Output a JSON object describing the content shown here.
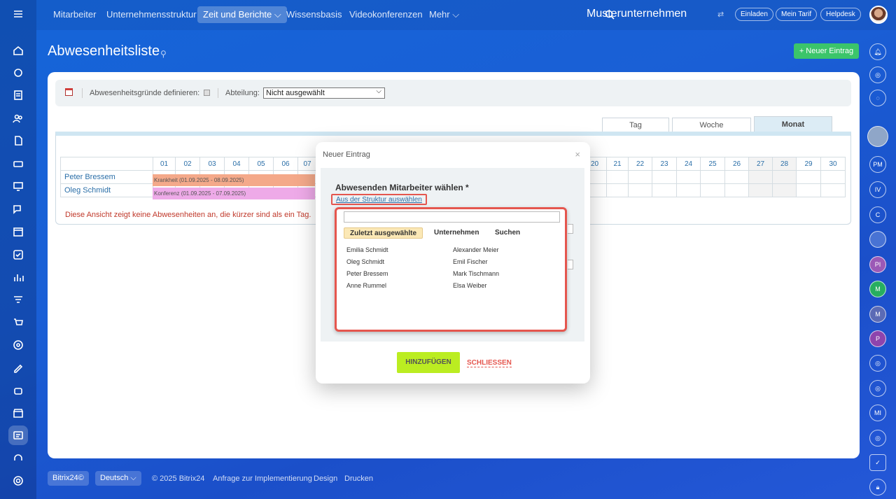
{
  "nav": {
    "items": [
      {
        "label": "Mitarbeiter"
      },
      {
        "label": "Unternehmensstruktur"
      },
      {
        "label": "Zeit und Berichte ⌵"
      },
      {
        "label": "Wissensbasis"
      },
      {
        "label": "Videokonferenzen"
      },
      {
        "label": "Mehr ⌵"
      }
    ],
    "company": "Musterunternehmen",
    "invite": "Einladen",
    "tariff": "Mein Tarif",
    "helpdesk": "Helpdesk"
  },
  "page": {
    "title": "Abwesenheitsliste",
    "new_entry": "+ Neuer Eintrag"
  },
  "filter": {
    "reasons_label": "Abwesenheitsgründe definieren:",
    "department_label": "Abteilung:",
    "department_value": "Nicht ausgewählt"
  },
  "view_tabs": {
    "day": "Tag",
    "week": "Woche",
    "month": "Monat"
  },
  "calendar": {
    "days_left": [
      "01",
      "02",
      "03",
      "04",
      "05",
      "06",
      "07"
    ],
    "days_right": [
      "20",
      "21",
      "22",
      "23",
      "24",
      "25",
      "26",
      "27",
      "28",
      "29",
      "30"
    ],
    "rows": [
      {
        "name": "Peter Bressem",
        "event": "Krankheit (01.09.2025 - 08.09.2025)"
      },
      {
        "name": "Oleg Schmidt",
        "event": "Konferenz (01.09.2025 - 07.09.2025)"
      }
    ],
    "note": "Diese Ansicht zeigt keine Abwesenheiten an, die kürzer sind als ein Tag."
  },
  "dialog": {
    "title": "Neuer Eintrag",
    "close": "×",
    "employee_label": "Abwesenden Mitarbeiter wählen *",
    "structure_link": "Aus der Struktur auswählen",
    "picker_tabs": {
      "recent": "Zuletzt ausgewählte",
      "company": "Unternehmen",
      "search": "Suchen"
    },
    "people_left": [
      "Emilia Schmidt",
      "Oleg Schmidt",
      "Peter Bressem",
      "Anne Rummel"
    ],
    "people_right": [
      "Alexander Meier",
      "Emil Fischer",
      "Mark Tischmann",
      "Elsa Weiber"
    ],
    "add": "HINZUFÜGEN",
    "close_button": "SCHLIESSEN"
  },
  "footer": {
    "brand": "Bitrix24©",
    "language": "Deutsch ⌵",
    "copyright": "© 2025 Bitrix24",
    "implementation": "Anfrage zur Implementierung",
    "design": "Design",
    "print": "Drucken"
  },
  "right_rail": {
    "initials": [
      "PM",
      "IV",
      "C",
      "PI",
      "M",
      "M",
      "P",
      "MI"
    ]
  }
}
